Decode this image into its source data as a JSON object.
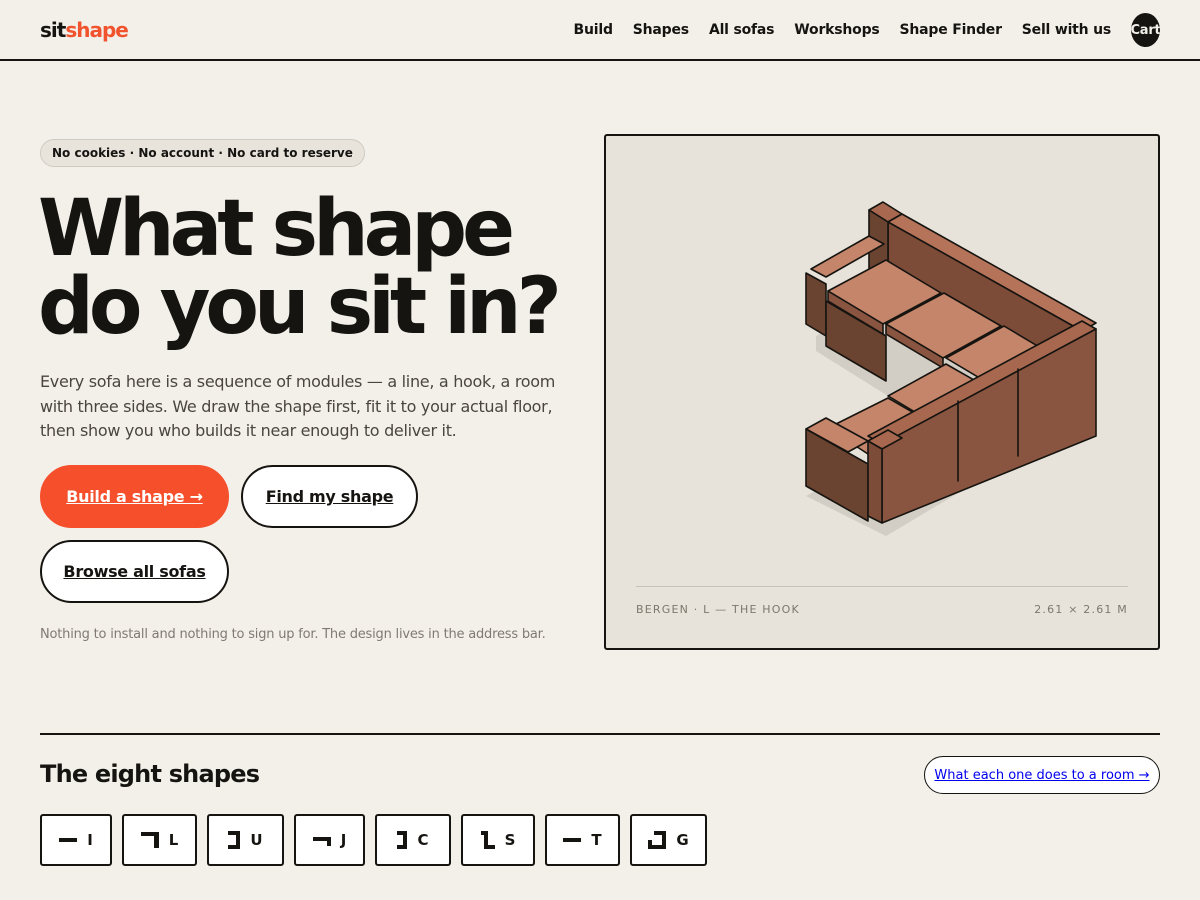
{
  "header": {
    "logo_a": "sit",
    "logo_b": "shape",
    "nav": [
      "Build",
      "Shapes",
      "All sofas",
      "Workshops",
      "Shape Finder",
      "Sell with us"
    ],
    "cart_label": "Cart"
  },
  "hero": {
    "badge": "No cookies · No account · No card to reserve",
    "title_line1": "What shape",
    "title_line2": "do you sit in?",
    "body": "Every sofa here is a sequence of modules — a line, a hook, a room with three sides. We draw the shape first, fit it to your actual floor, then show you who builds it near enough to deliver it.",
    "btn_build": "Build a shape →",
    "btn_find": "Find my shape",
    "btn_browse": "Browse all sofas",
    "footnote": "Nothing to install and nothing to sign up for. The design lives in the address bar."
  },
  "preview": {
    "caption_left": "BERGEN · L — THE HOOK",
    "caption_right": "2.61 × 2.61 M",
    "colors": {
      "seat": "#c4856a",
      "side": "#8a5540",
      "dark": "#6b4331",
      "shadow": "#d3cec5"
    }
  },
  "shapes": {
    "title": "The eight shapes",
    "link": "What each one does to a room →",
    "items": [
      {
        "letter": "I"
      },
      {
        "letter": "L"
      },
      {
        "letter": "U"
      },
      {
        "letter": "J"
      },
      {
        "letter": "C"
      },
      {
        "letter": "S"
      },
      {
        "letter": "T"
      },
      {
        "letter": "G"
      }
    ]
  }
}
